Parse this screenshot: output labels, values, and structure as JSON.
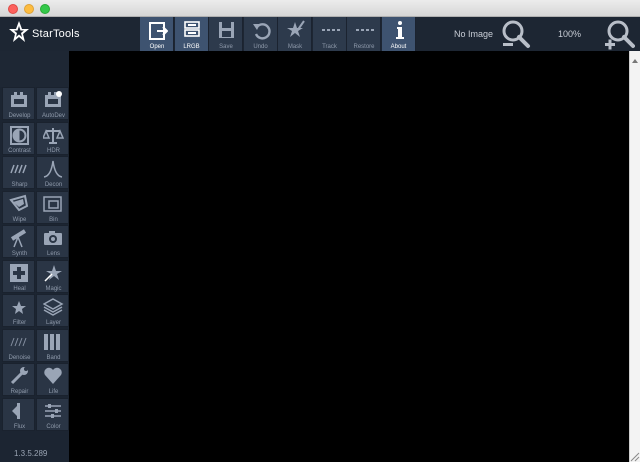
{
  "app": {
    "name": "StarTools",
    "version": "1.3.5.289"
  },
  "toolbar": [
    {
      "id": "open",
      "label": "Open",
      "icon": "open-icon",
      "active": true
    },
    {
      "id": "lrgb",
      "label": "LRGB",
      "icon": "lrgb-icon",
      "active": true
    },
    {
      "id": "save",
      "label": "Save",
      "icon": "save-icon",
      "active": false
    },
    {
      "id": "undo",
      "label": "Undo",
      "icon": "undo-icon",
      "active": false
    },
    {
      "id": "mask",
      "label": "Mask",
      "icon": "mask-icon",
      "active": false
    },
    {
      "id": "track",
      "label": "Track",
      "icon": "track-icon",
      "active": false
    },
    {
      "id": "restore",
      "label": "Restore",
      "icon": "restore-icon",
      "active": false
    },
    {
      "id": "about",
      "label": "About",
      "icon": "info-icon",
      "active": true
    }
  ],
  "status": {
    "image_text": "No Image",
    "zoom_text": "100%"
  },
  "modules": [
    {
      "id": "develop",
      "label": "Develop",
      "icon": "develop-icon"
    },
    {
      "id": "autodev",
      "label": "AutoDev",
      "icon": "autodev-icon"
    },
    {
      "id": "contrast",
      "label": "Contrast",
      "icon": "contrast-icon"
    },
    {
      "id": "hdr",
      "label": "HDR",
      "icon": "hdr-icon"
    },
    {
      "id": "sharp",
      "label": "Sharp",
      "icon": "sharp-icon"
    },
    {
      "id": "decon",
      "label": "Decon",
      "icon": "decon-icon"
    },
    {
      "id": "wipe",
      "label": "Wipe",
      "icon": "wipe-icon"
    },
    {
      "id": "bin",
      "label": "Bin",
      "icon": "bin-icon"
    },
    {
      "id": "synth",
      "label": "Synth",
      "icon": "telescope-icon"
    },
    {
      "id": "lens",
      "label": "Lens",
      "icon": "camera-icon"
    },
    {
      "id": "heal",
      "label": "Heal",
      "icon": "heal-icon"
    },
    {
      "id": "magic",
      "label": "Magic",
      "icon": "magic-icon"
    },
    {
      "id": "filter",
      "label": "Filter",
      "icon": "filter-icon"
    },
    {
      "id": "layer",
      "label": "Layer",
      "icon": "layer-icon"
    },
    {
      "id": "denoise",
      "label": "Denoise",
      "icon": "denoise-icon"
    },
    {
      "id": "band",
      "label": "Band",
      "icon": "band-icon"
    },
    {
      "id": "repair",
      "label": "Repair",
      "icon": "wrench-icon"
    },
    {
      "id": "life",
      "label": "Life",
      "icon": "heart-icon"
    },
    {
      "id": "flux",
      "label": "Flux",
      "icon": "flux-icon"
    },
    {
      "id": "color",
      "label": "Color",
      "icon": "color-icon"
    }
  ],
  "colors": {
    "panel": "#1c2532",
    "button": "#2a3545",
    "active_button": "#3e5370",
    "canvas": "#000000",
    "icon": "#9aa5b6"
  }
}
